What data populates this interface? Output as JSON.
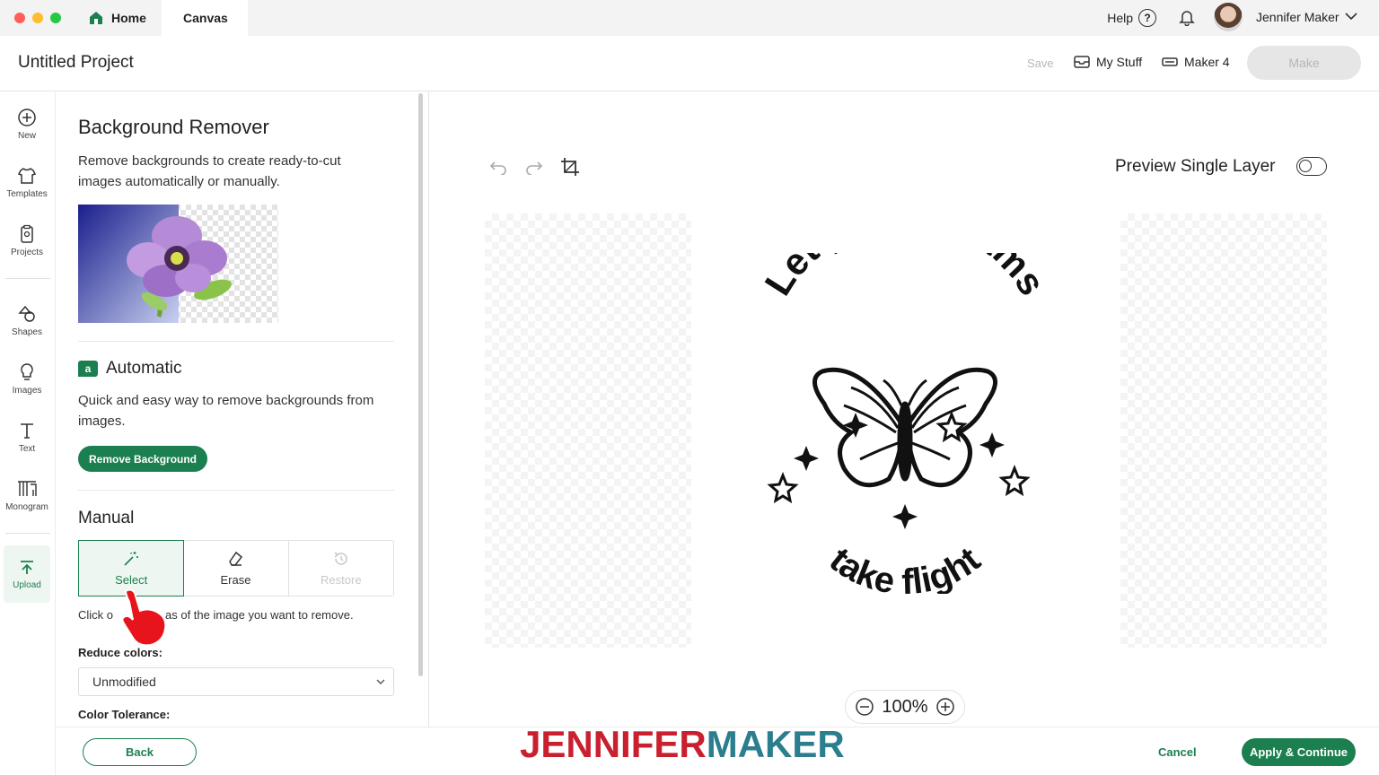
{
  "titlebar": {
    "tabs": [
      {
        "label": "Home"
      },
      {
        "label": "Canvas"
      }
    ],
    "help_label": "Help",
    "user_name": "Jennifer Maker"
  },
  "header": {
    "project_title": "Untitled Project",
    "save_label": "Save",
    "my_stuff_label": "My Stuff",
    "machine_label": "Maker 4",
    "make_label": "Make"
  },
  "leftnav": {
    "items": [
      {
        "label": "New",
        "icon": "plus-circle-icon"
      },
      {
        "label": "Templates",
        "icon": "shirt-icon"
      },
      {
        "label": "Projects",
        "icon": "projects-icon"
      },
      {
        "label": "Shapes",
        "icon": "shapes-icon"
      },
      {
        "label": "Images",
        "icon": "lightbulb-icon"
      },
      {
        "label": "Text",
        "icon": "text-icon"
      },
      {
        "label": "Monogram",
        "icon": "monogram-icon"
      },
      {
        "label": "Upload",
        "icon": "upload-icon"
      }
    ]
  },
  "panel": {
    "title": "Background Remover",
    "description": "Remove backgrounds to create ready-to-cut images automatically or manually.",
    "automatic": {
      "badge": "a",
      "title": "Automatic",
      "description": "Quick and easy way to remove backgrounds from images.",
      "button_label": "Remove Background"
    },
    "manual": {
      "title": "Manual",
      "tools": [
        {
          "label": "Select",
          "icon": "magic-wand-icon",
          "state": "active"
        },
        {
          "label": "Erase",
          "icon": "eraser-icon",
          "state": "normal"
        },
        {
          "label": "Restore",
          "icon": "restore-icon",
          "state": "disabled"
        }
      ],
      "hint_start": "Click o",
      "hint_end": "as of the image you want to remove.",
      "reduce_colors_label": "Reduce colors:",
      "reduce_colors_value": "Unmodified",
      "color_tolerance_label": "Color Tolerance:"
    }
  },
  "canvas": {
    "preview_label": "Preview Single Layer",
    "preview_enabled": false,
    "zoom": "100%",
    "artwork": {
      "top_text": "Let your dreams",
      "bottom_text": "take flight"
    }
  },
  "footer": {
    "back_label": "Back",
    "brand_part1": "JENNIFER",
    "brand_part2": "MAKER",
    "cancel_label": "Cancel",
    "apply_label": "Apply & Continue"
  },
  "colors": {
    "accent": "#1c7f4f",
    "brand_red": "#c8202f",
    "brand_teal": "#2a7e8d"
  }
}
